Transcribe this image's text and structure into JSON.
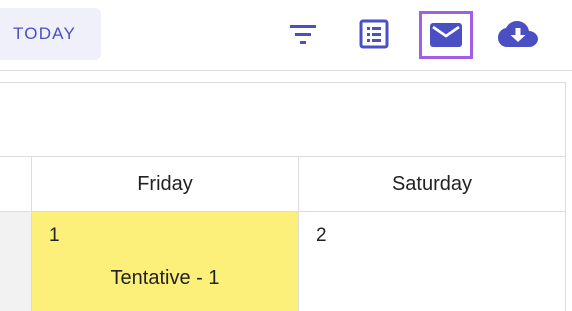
{
  "toolbar": {
    "today_label": "TODAY",
    "icons": {
      "filter": "filter-icon",
      "list": "list-view-icon",
      "mail": "mail-icon",
      "download": "cloud-download-icon"
    },
    "accent_color": "#4b4fc4",
    "active_outline_color": "#a45ee5"
  },
  "calendar": {
    "days": [
      {
        "name": "Friday",
        "date": "1",
        "event": "Tentative - 1",
        "event_color": "#fdf07a"
      },
      {
        "name": "Saturday",
        "date": "2",
        "event": ""
      }
    ]
  }
}
